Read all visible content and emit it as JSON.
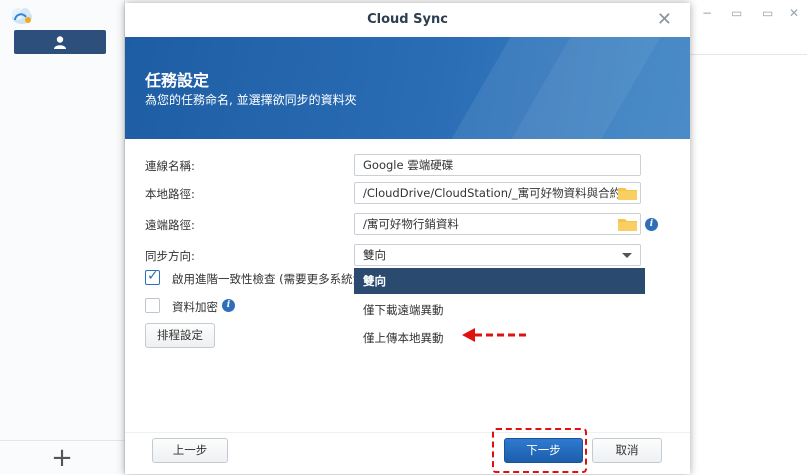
{
  "background_app": {
    "user_button_icon": "user-icon",
    "add_button_label": "+",
    "window_controls": [
      "−",
      "▭",
      "✕"
    ]
  },
  "dialog": {
    "title": "Cloud Sync",
    "header": {
      "title": "任務設定",
      "subtitle": "為您的任務命名, 並選擇欲同步的資料夾"
    },
    "form": {
      "connection_name": {
        "label": "連線名稱:",
        "value": "Google 雲端硬碟"
      },
      "local_path": {
        "label": "本地路徑:",
        "value": "/CloudDrive/CloudStation/_寓可好物資料與合約"
      },
      "remote_path": {
        "label": "遠端路徑:",
        "value": "/寓可好物行銷資料"
      },
      "sync_direction": {
        "label": "同步方向:",
        "value": "雙向",
        "options": [
          "雙向",
          "僅下載遠端異動",
          "僅上傳本地異動"
        ],
        "selected_index": 0
      },
      "advanced_check": {
        "label": "啟用進階一致性檢查 (需要更多系統資",
        "checked": true
      },
      "encryption": {
        "label": "資料加密",
        "checked": false
      },
      "schedule_button": "排程設定"
    },
    "footer": {
      "back_label": "上一步",
      "next_label": "下一步",
      "cancel_label": "取消"
    }
  },
  "colors": {
    "header_blue": "#2a6db5",
    "primary_button": "#1c5eab",
    "dropdown_selected": "#2b4a6f",
    "annotation_red": "#e01010",
    "folder_yellow": "#f7c34a"
  }
}
